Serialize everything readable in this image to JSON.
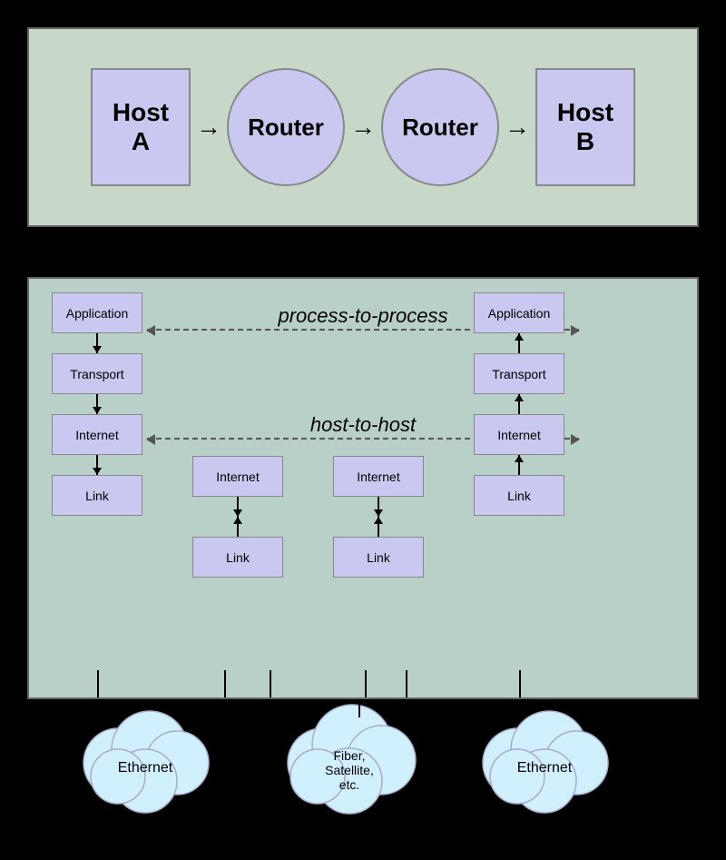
{
  "top": {
    "hostA": "Host\nA",
    "hostB": "Host\nB",
    "router": "Router"
  },
  "bottom": {
    "p2p": "process-to-process",
    "h2h": "host-to-host",
    "layers": {
      "application": "Application",
      "transport": "Transport",
      "internet": "Internet",
      "link": "Link"
    }
  },
  "physical": {
    "ethernet1": "Ethernet",
    "fiber": "Fiber,\nSatellite,\netc.",
    "ethernet2": "Ethernet"
  }
}
